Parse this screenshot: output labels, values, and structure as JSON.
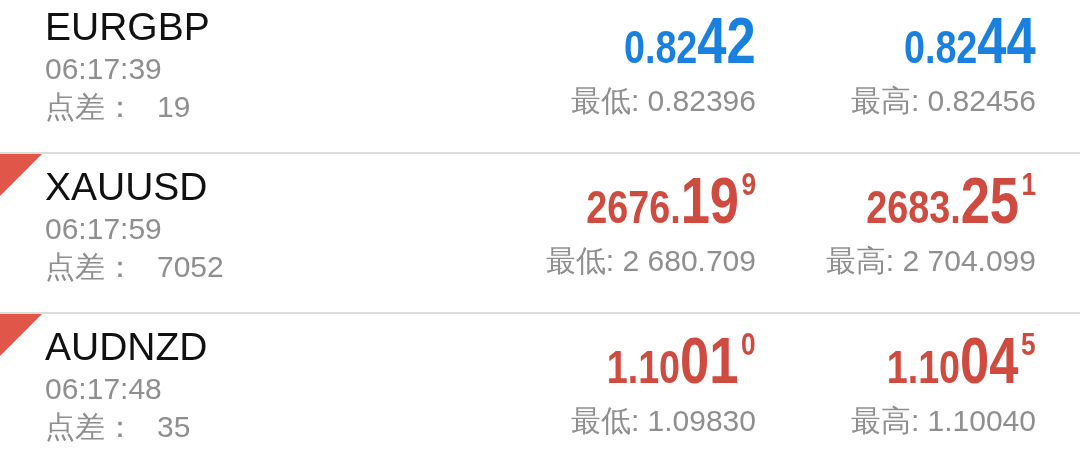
{
  "quotes": [
    {
      "symbol": "EURGBP",
      "falling": false,
      "time": "06:17:39",
      "spread_label": "点差：",
      "spread": "19",
      "bid": {
        "prefix": "0.82",
        "big": "42"
      },
      "ask": {
        "prefix": "0.82",
        "big": "44"
      },
      "low": "最低: 0.82396",
      "high": "最高: 0.82456"
    },
    {
      "symbol": "XAUUSD",
      "falling": true,
      "time": "06:17:59",
      "spread_label": "点差：",
      "spread": "7052",
      "bid": {
        "prefix": "2676.",
        "big": "19",
        "sup": "9"
      },
      "ask": {
        "prefix": "2683.",
        "big": "25",
        "sup": "1"
      },
      "low": "最低: 2 680.709",
      "high": "最高: 2 704.099"
    },
    {
      "symbol": "AUDNZD",
      "falling": true,
      "time": "06:17:48",
      "spread_label": "点差：",
      "spread": "35",
      "bid": {
        "prefix": "1.10",
        "big": "01",
        "sup": "0"
      },
      "ask": {
        "prefix": "1.10",
        "big": "04",
        "sup": "5"
      },
      "low": "最低: 1.09830",
      "high": "最高: 1.10040"
    }
  ]
}
